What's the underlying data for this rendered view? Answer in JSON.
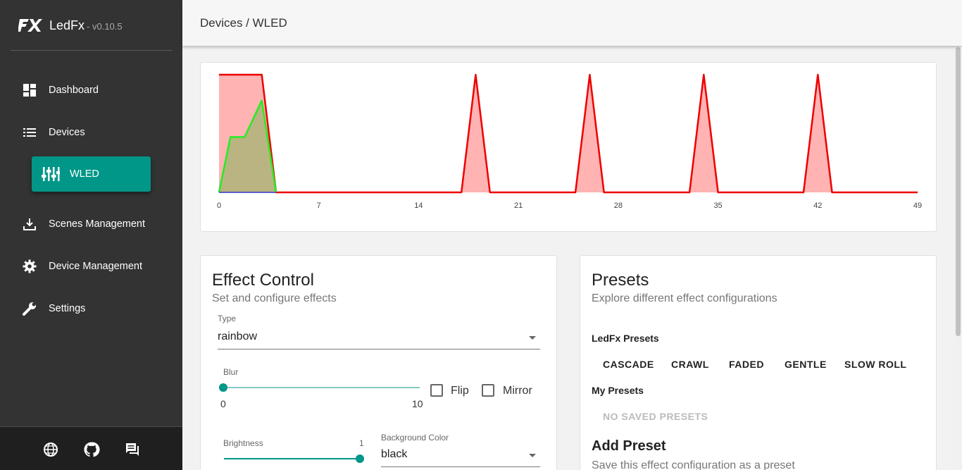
{
  "app": {
    "name": "LedFx",
    "version": "- v0.10.5"
  },
  "sidebar": {
    "items": [
      {
        "label": "Dashboard",
        "icon": "dashboard-icon"
      },
      {
        "label": "Devices",
        "icon": "list-icon"
      },
      {
        "label": "WLED",
        "icon": "equalizer-icon",
        "active": true
      },
      {
        "label": "Scenes Management",
        "icon": "download-icon"
      },
      {
        "label": "Device Management",
        "icon": "gear-icon"
      },
      {
        "label": "Settings",
        "icon": "wrench-icon"
      }
    ],
    "footer": [
      "globe-icon",
      "github-icon",
      "chat-icon"
    ]
  },
  "header": {
    "breadcrumb": "Devices / WLED"
  },
  "chart_data": {
    "type": "area",
    "x_ticks": [
      0,
      7,
      14,
      21,
      28,
      35,
      42,
      49
    ],
    "xlim": [
      0,
      49
    ],
    "ylim": [
      0,
      1
    ],
    "series": [
      {
        "color": "#ee0000",
        "fill": "#ffb3b3",
        "points": [
          [
            0,
            1
          ],
          [
            3,
            1
          ],
          [
            4,
            0
          ],
          [
            17,
            0
          ],
          [
            18,
            1
          ],
          [
            19,
            0
          ],
          [
            25,
            0
          ],
          [
            26,
            1
          ],
          [
            27,
            0
          ],
          [
            33,
            0
          ],
          [
            34,
            1
          ],
          [
            35,
            0
          ],
          [
            41,
            0
          ],
          [
            42,
            1
          ],
          [
            43,
            0
          ],
          [
            49,
            0
          ]
        ]
      },
      {
        "color": "#22ee22",
        "fill": "rgba(130,180,90,0.55)",
        "points": [
          [
            0,
            0
          ],
          [
            0.8,
            0.47
          ],
          [
            1.8,
            0.47
          ],
          [
            3,
            0.78
          ],
          [
            4,
            0
          ]
        ]
      },
      {
        "color": "#3333cc",
        "points": [
          [
            0,
            0
          ],
          [
            4,
            0
          ]
        ]
      }
    ]
  },
  "effect_control": {
    "title": "Effect Control",
    "subtitle": "Set and configure effects",
    "type_label": "Type",
    "type_value": "rainbow",
    "blur_label": "Blur",
    "blur_min": "0",
    "blur_max": "10",
    "blur_value": 0,
    "flip_label": "Flip",
    "mirror_label": "Mirror",
    "brightness_label": "Brightness",
    "brightness_value": "1",
    "brightness_level": 1,
    "bg_color_label": "Background Color",
    "bg_color_value": "black"
  },
  "presets": {
    "title": "Presets",
    "subtitle": "Explore different effect configurations",
    "ledfx_label": "LedFx Presets",
    "ledfx_items": [
      "CASCADE",
      "CRAWL",
      "FADED",
      "GENTLE",
      "SLOW ROLL"
    ],
    "my_label": "My Presets",
    "my_empty": "NO SAVED PRESETS",
    "add_title": "Add Preset",
    "add_subtitle": "Save this effect configuration as a preset"
  },
  "colors": {
    "accent": "#009688",
    "sidebar": "#333333",
    "footer": "#1f1f1f"
  }
}
